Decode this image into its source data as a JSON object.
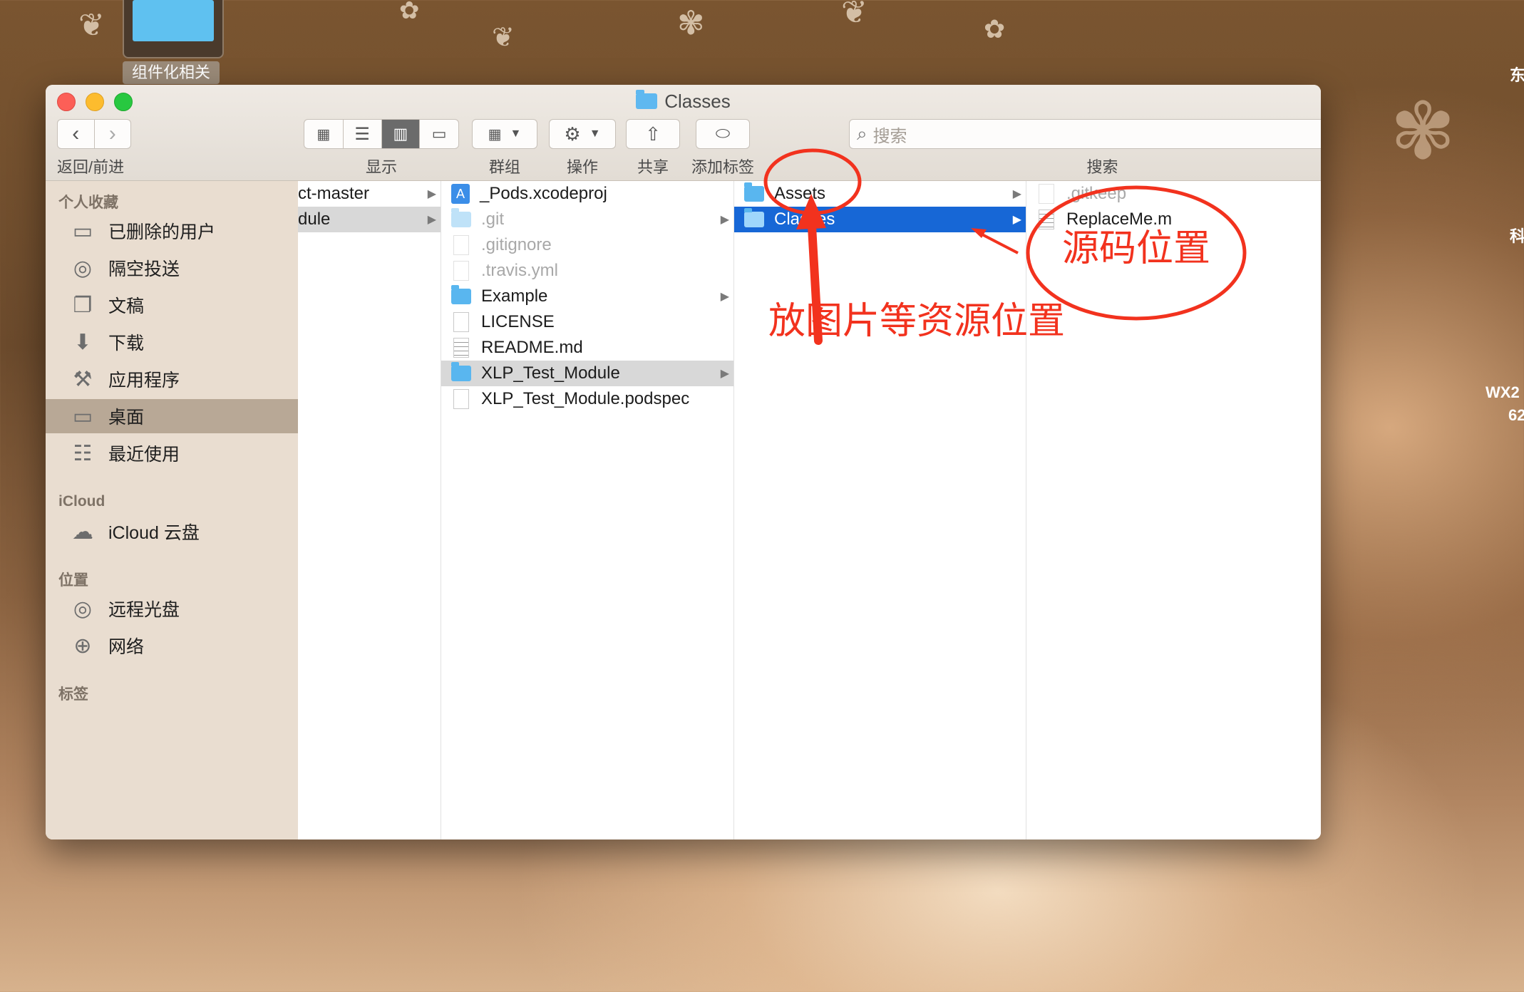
{
  "desktop": {
    "folder_label": "组件化相关",
    "edge_texts": [
      "东",
      "科",
      "WX2",
      "62"
    ]
  },
  "window": {
    "title": "Classes",
    "toolbar": {
      "nav_label": "返回/前进",
      "view_label": "显示",
      "group_label": "群组",
      "action_label": "操作",
      "share_label": "共享",
      "tag_label": "添加标签",
      "search_placeholder": "搜索",
      "search_label": "搜索"
    },
    "sidebar": {
      "favorites_header": "个人收藏",
      "favorites": [
        {
          "label": "已删除的用户",
          "icon": "folder-icon"
        },
        {
          "label": "隔空投送",
          "icon": "airdrop-icon"
        },
        {
          "label": "文稿",
          "icon": "documents-icon"
        },
        {
          "label": "下载",
          "icon": "download-icon"
        },
        {
          "label": "应用程序",
          "icon": "applications-icon"
        },
        {
          "label": "桌面",
          "icon": "desktop-icon"
        },
        {
          "label": "最近使用",
          "icon": "recents-icon"
        }
      ],
      "icloud_header": "iCloud",
      "icloud_items": [
        {
          "label": "iCloud 云盘",
          "icon": "cloud-icon"
        }
      ],
      "locations_header": "位置",
      "locations": [
        {
          "label": "远程光盘",
          "icon": "disc-icon"
        },
        {
          "label": "网络",
          "icon": "network-icon"
        }
      ],
      "tags_header": "标签"
    },
    "columns": {
      "col1": [
        "ct-master",
        "dule"
      ],
      "col2": [
        "_Pods.xcodeproj",
        ".git",
        ".gitignore",
        ".travis.yml",
        "Example",
        "LICENSE",
        "README.md",
        "XLP_Test_Module",
        "XLP_Test_Module.podspec"
      ],
      "col3": [
        "Assets",
        "Classes"
      ],
      "col4": [
        ".gitkeep",
        "ReplaceMe.m"
      ]
    }
  },
  "annotations": {
    "assets_note": "放图片等资源位置",
    "classes_note": "源码位置",
    "color": "#f2321e"
  }
}
